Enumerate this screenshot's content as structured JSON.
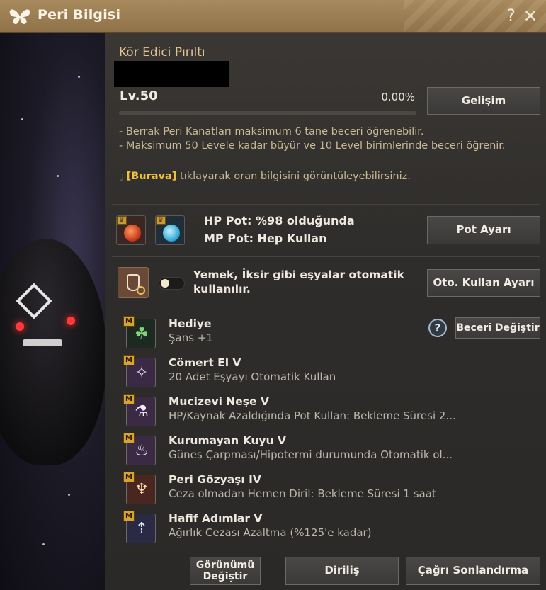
{
  "window": {
    "title": "Peri Bilgisi",
    "icons": [
      "butterfly-icon",
      "help-icon",
      "close-icon"
    ]
  },
  "peri": {
    "name": "Kör Edici Pırıltı",
    "level": "Lv.50",
    "progress_text": "0.00%",
    "progress_fraction": 0.0
  },
  "buttons": {
    "gelisim": "Gelişim",
    "pot_ayari": "Pot Ayarı",
    "oto_kullan": "Oto. Kullan Ayarı",
    "beceri_degistir": "Beceri Değiştir",
    "gorunum_degistir": "Görünümü Değiştir",
    "dirilis": "Diriliş",
    "cagri_sonlandirma": "Çağrı Sonlandırma"
  },
  "info": {
    "line1": "- Berrak Peri Kanatları maksimum 6 tane beceri öğrenebilir.",
    "line2": "- Maksimum 50 Levele kadar büyür ve 10 Level birimlerinde beceri öğrenir.",
    "link_label": "[Burava]",
    "link_suffix": " tıklayarak oran bilgisini görüntüleyebilirsiniz."
  },
  "pot": {
    "hp": "HP Pot: %98 olduğunda",
    "mp": "MP Pot: Hep Kullan"
  },
  "food": {
    "text": "Yemek, İksir gibi eşyalar otomatik kullanılır.",
    "toggle_on": false
  },
  "skills": [
    {
      "badge": "M",
      "name": "Hediye",
      "desc": "Şans +1",
      "icon": "clover-icon",
      "bg": "#1d2a22"
    },
    {
      "badge": "M",
      "name": "Cömert El V",
      "desc": "20 Adet Eşyayı Otomatik Kullan",
      "icon": "fairy-icon",
      "bg": "#3a2a44"
    },
    {
      "badge": "M",
      "name": "Mucizevi Neşe V",
      "desc": "HP/Kaynak Azaldığında Pot Kullan: Bekleme Süresi 2...",
      "icon": "potion-plus-icon",
      "bg": "#3a2a44"
    },
    {
      "badge": "M",
      "name": "Kurumayan Kuyu V",
      "desc": "Güneş Çarpması/Hipotermi durumunda Otomatik ol...",
      "icon": "bowl-icon",
      "bg": "#3a2a44"
    },
    {
      "badge": "M",
      "name": "Peri Gözyaşı IV",
      "desc": "Ceza olmadan Hemen Diril: Bekleme Süresi 1 saat",
      "icon": "tear-vial-icon",
      "bg": "#4a2620"
    },
    {
      "badge": "M",
      "name": "Hafif Adımlar V",
      "desc": "Ağırlık Cezası Azaltma (%125'e kadar)",
      "icon": "weight-up-icon",
      "bg": "#2a2a44"
    }
  ],
  "help_glyph": "?"
}
